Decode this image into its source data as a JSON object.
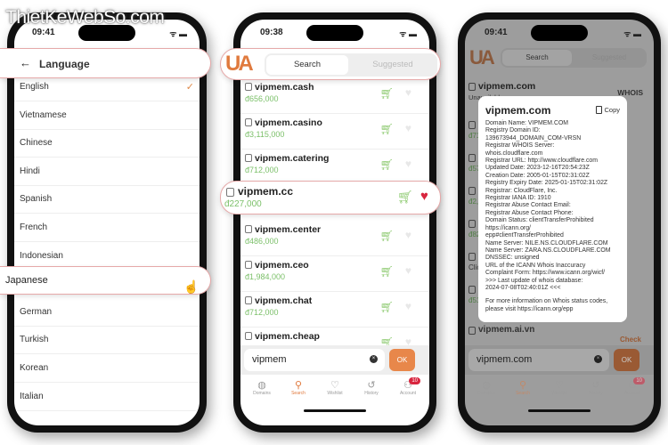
{
  "watermark": "ThietKeWebSo.com",
  "colors": {
    "accent": "#e07a3e",
    "price": "#7cc06a",
    "heart_active": "#d8263f",
    "popout_border": "#e6a9a9"
  },
  "phone1": {
    "time": "09:41",
    "header": {
      "back_icon": "arrow-left-icon",
      "title": "Language"
    },
    "languages": [
      "English",
      "Vietnamese",
      "Chinese",
      "Hindi",
      "Spanish",
      "French",
      "Indonesian",
      "Japanese",
      "German",
      "Turkish",
      "Korean",
      "Italian"
    ],
    "selected": "English",
    "highlighted": "Japanese"
  },
  "phone2": {
    "time": "09:38",
    "tabs": {
      "search": "Search",
      "suggested": "Suggested"
    },
    "results": [
      {
        "name": "vipmem.cash",
        "price": "đ656,000",
        "wishlisted": false
      },
      {
        "name": "vipmem.casino",
        "price": "đ3,115,000",
        "wishlisted": false
      },
      {
        "name": "vipmem.catering",
        "price": "đ712,000",
        "wishlisted": false
      },
      {
        "name": "vipmem.cc",
        "price": "đ227,000",
        "wishlisted": true
      },
      {
        "name": "vipmem.center",
        "price": "đ486,000",
        "wishlisted": false
      },
      {
        "name": "vipmem.ceo",
        "price": "đ1,984,000",
        "wishlisted": false
      },
      {
        "name": "vipmem.chat",
        "price": "đ712,000",
        "wishlisted": false
      },
      {
        "name": "vipmem.cheap",
        "price": "",
        "wishlisted": false
      }
    ],
    "search_value": "vipmem",
    "ok_label": "OK"
  },
  "tabbar": [
    {
      "label": "Domains",
      "icon": "globe-icon"
    },
    {
      "label": "Search",
      "icon": "search-icon",
      "active": true
    },
    {
      "label": "Wishlist",
      "icon": "heart-icon"
    },
    {
      "label": "History",
      "icon": "history-icon"
    },
    {
      "label": "Account",
      "icon": "user-icon",
      "badge": "10"
    }
  ],
  "phone3": {
    "time": "09:41",
    "tabs": {
      "search": "Search",
      "suggested": "Suggested"
    },
    "top_result": {
      "name": "vipmem.com",
      "status": "Unavailable",
      "action": "WHOIS"
    },
    "bottom_result": {
      "name": "vipmem.ai.vn",
      "action": "Check"
    },
    "partial_prices": [
      "đ71",
      "đ57",
      "đ2,",
      "đ82",
      "Clic",
      "đ51"
    ],
    "search_value": "vipmem.com",
    "ok_label": "OK",
    "modal": {
      "title": "vipmem.com",
      "copy_label": "Copy",
      "body": "Domain Name: VIPMEM.COM\nRegistry Domain ID:\n139673944_DOMAIN_COM-VRSN\nRegistrar WHOIS Server:\nwhois.cloudflare.com\nRegistrar URL: http://www.cloudflare.com\nUpdated Date: 2023-12-16T20:54:23Z\nCreation Date: 2005-01-15T02:31:02Z\nRegistry Expiry Date: 2025-01-15T02:31:02Z\nRegistrar: CloudFlare, Inc.\nRegistrar IANA ID: 1910\nRegistrar Abuse Contact Email:\nRegistrar Abuse Contact Phone:\nDomain Status: clientTransferProhibited\nhttps://icann.org/\nepp#clientTransferProhibited\nName Server: NILE.NS.CLOUDFLARE.COM\nName Server: ZARA.NS.CLOUDFLARE.COM\nDNSSEC: unsigned\nURL of the ICANN Whois Inaccuracy\nComplaint Form: https://www.icann.org/wicf/\n>>> Last update of whois database:\n2024-07-08T02:40:01Z <<<",
      "footer": "For more information on Whois status codes,\nplease visit https://icann.org/epp"
    }
  }
}
